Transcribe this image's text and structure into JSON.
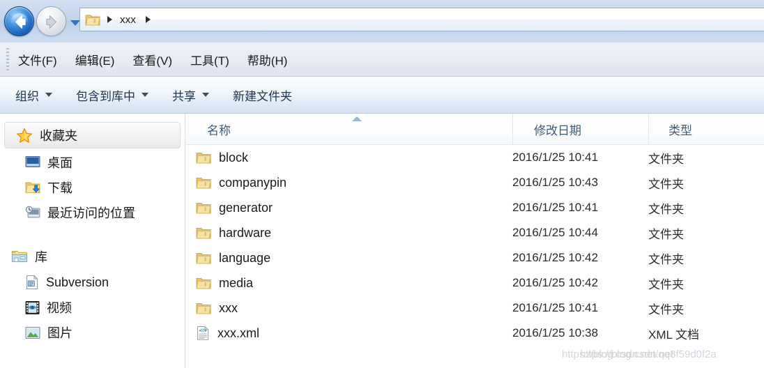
{
  "window": {
    "title": "xxx"
  },
  "navbar": {
    "back_icon": "back-arrow-icon",
    "forward_icon": "forward-arrow-icon",
    "recent_dropdown_icon": "chevron-down-icon",
    "address": {
      "folder_icon": "folder-icon",
      "separator": "▶",
      "crumbs": [
        {
          "label": "xxx"
        }
      ]
    }
  },
  "menubar": {
    "items": [
      {
        "label": "文件(F)"
      },
      {
        "label": "编辑(E)"
      },
      {
        "label": "查看(V)"
      },
      {
        "label": "工具(T)"
      },
      {
        "label": "帮助(H)"
      }
    ]
  },
  "toolbar": {
    "items": [
      {
        "label": "组织",
        "has_caret": true
      },
      {
        "label": "包含到库中",
        "has_caret": true
      },
      {
        "label": "共享",
        "has_caret": true
      },
      {
        "label": "新建文件夹",
        "has_caret": false
      }
    ]
  },
  "sidebar": {
    "groups": [
      {
        "label": "收藏夹",
        "icon": "star-icon",
        "highlighted": true,
        "items": [
          {
            "label": "桌面",
            "icon": "desktop-icon"
          },
          {
            "label": "下载",
            "icon": "downloads-folder-icon"
          },
          {
            "label": "最近访问的位置",
            "icon": "recent-places-icon"
          }
        ]
      },
      {
        "label": "库",
        "icon": "library-icon",
        "highlighted": false,
        "items": [
          {
            "label": "Subversion",
            "icon": "subversion-document-icon"
          },
          {
            "label": "视频",
            "icon": "video-library-icon"
          },
          {
            "label": "图片",
            "icon": "pictures-library-icon"
          }
        ]
      }
    ]
  },
  "filelist": {
    "columns": [
      {
        "key": "name",
        "label": "名称",
        "sorted": "asc"
      },
      {
        "key": "date",
        "label": "修改日期",
        "sorted": ""
      },
      {
        "key": "type",
        "label": "类型",
        "sorted": ""
      }
    ],
    "rows": [
      {
        "name": "block",
        "date": "2016/1/25 10:41",
        "type": "文件夹",
        "icon": "folder-icon"
      },
      {
        "name": "companypin",
        "date": "2016/1/25 10:43",
        "type": "文件夹",
        "icon": "folder-icon"
      },
      {
        "name": "generator",
        "date": "2016/1/25 10:41",
        "type": "文件夹",
        "icon": "folder-icon"
      },
      {
        "name": "hardware",
        "date": "2016/1/25 10:44",
        "type": "文件夹",
        "icon": "folder-icon"
      },
      {
        "name": "language",
        "date": "2016/1/25 10:42",
        "type": "文件夹",
        "icon": "folder-icon"
      },
      {
        "name": "media",
        "date": "2016/1/25 10:42",
        "type": "文件夹",
        "icon": "folder-icon"
      },
      {
        "name": "xxx",
        "date": "2016/1/25 10:41",
        "type": "文件夹",
        "icon": "folder-icon"
      },
      {
        "name": "xxx.xml",
        "date": "2016/1/25 10:38",
        "type": "XML 文档",
        "icon": "xml-document-icon"
      }
    ]
  },
  "watermark": {
    "line_a": "https://blog.csdn.net/qq8f59d0f2a",
    "line_b": "https://blog.csdn.net"
  },
  "colors": {
    "nav_bar": "#c2d5ec",
    "menu_bar": "#e6eaf3",
    "accent_blue": "#3f93e0",
    "folder_yellow": "#f5d98a",
    "header_text": "#3f5a7d"
  }
}
